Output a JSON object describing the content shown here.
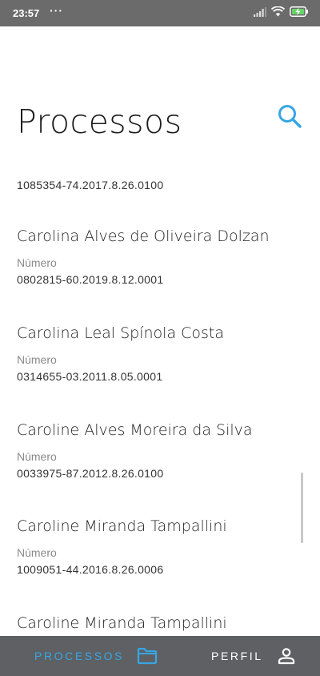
{
  "status_bar": {
    "time": "23:57",
    "dots": "···",
    "battery_label": "battery-charging-icon"
  },
  "header": {
    "title": "Processos",
    "search_icon": "search-icon"
  },
  "partial_item": {
    "number": "1085354-74.2017.8.26.0100"
  },
  "items": [
    {
      "name": "Carolina Alves de Oliveira Dolzan",
      "label": "Número",
      "number": "0802815-60.2019.8.12.0001"
    },
    {
      "name": "Carolina Leal Spínola Costa",
      "label": "Número",
      "number": "0314655-03.2011.8.05.0001"
    },
    {
      "name": "Caroline Alves Moreira da Silva",
      "label": "Número",
      "number": "0033975-87.2012.8.26.0100"
    },
    {
      "name": "Caroline Miranda Tampallini",
      "label": "Número",
      "number": "1009051-44.2016.8.26.0006"
    },
    {
      "name": "Caroline Miranda Tampallini"
    }
  ],
  "bottom_nav": {
    "processos_label": "PROCESSOS",
    "perfil_label": "PERFIL",
    "active": "processos",
    "active_color": "#36a6e5",
    "background": "#5e6063"
  }
}
